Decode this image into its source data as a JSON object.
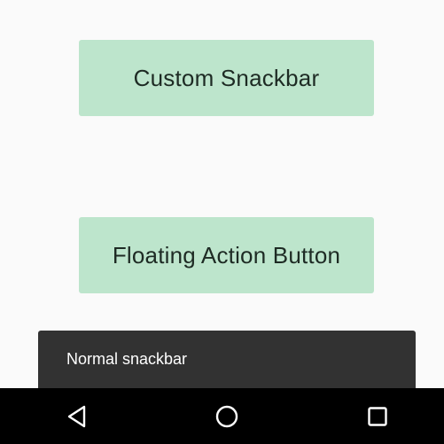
{
  "buttons": {
    "custom_snackbar": "Custom Snackbar",
    "floating_action_button": "Floating Action Button"
  },
  "snackbar": {
    "message": "Normal snackbar"
  },
  "navbar": {
    "back_icon": "back-triangle-icon",
    "home_icon": "home-circle-icon",
    "recents_icon": "recents-square-icon"
  },
  "colors": {
    "background": "#fafafa",
    "button_bg": "#bde5cc",
    "snackbar_bg": "#323232",
    "navbar_bg": "#000000"
  }
}
